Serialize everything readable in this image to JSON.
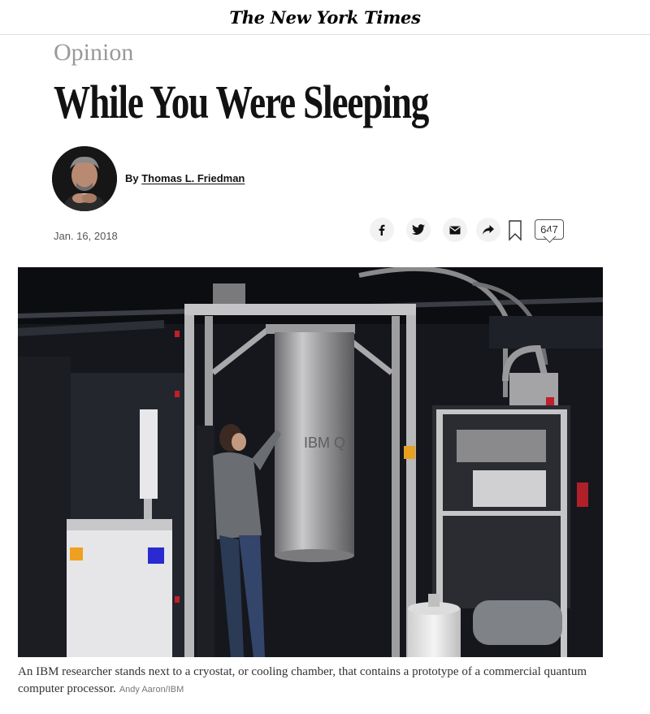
{
  "masthead": {
    "title": "The New York Times"
  },
  "article": {
    "section": "Opinion",
    "headline": "While You Were Sleeping",
    "byline_prefix": "By ",
    "author": "Thomas L. Friedman",
    "date": "Jan. 16, 2018"
  },
  "share": {
    "buttons": [
      {
        "icon": "facebook-icon",
        "glyph": "f"
      },
      {
        "icon": "twitter-icon",
        "glyph": ""
      },
      {
        "icon": "email-icon",
        "glyph": ""
      },
      {
        "icon": "share-icon",
        "glyph": ""
      }
    ],
    "comment_count": "647"
  },
  "photo": {
    "caption": "An IBM researcher stands next to a cryostat, or cooling chamber, that contains a prototype of a commercial quantum computer processor.",
    "credit": "Andy Aaron/IBM",
    "cylinder_label": "IBM Q"
  }
}
